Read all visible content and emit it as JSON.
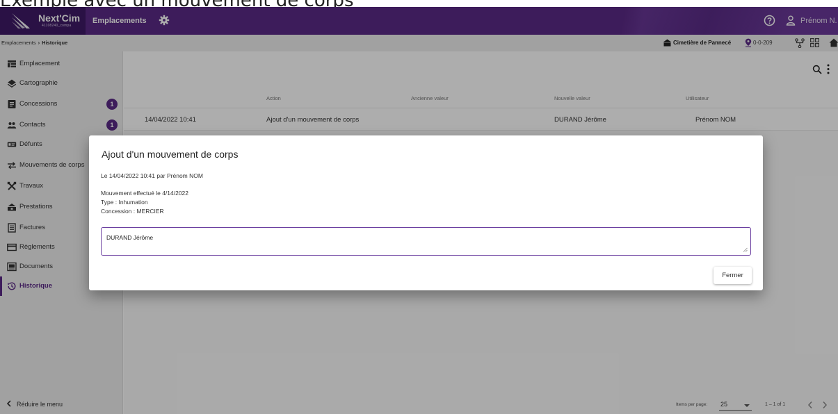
{
  "caption": "Exemple avec un mouvement de corps",
  "header": {
    "brand_name": "Next'Cim",
    "brand_sub": "41108240_compa",
    "app_title": "Emplacements",
    "user_name": "Prénom N.",
    "accent_color": "#5b2a86"
  },
  "breadcrumb": {
    "parent": "Emplacements",
    "separator": "›",
    "current": "Historique"
  },
  "context": {
    "cemetery": "Cimetière de Pannecé",
    "location": "0-0-209"
  },
  "sidebar": {
    "items": [
      {
        "label": "Emplacement",
        "icon": "emplacement-icon"
      },
      {
        "label": "Cartographie",
        "icon": "layers-icon"
      },
      {
        "label": "Concessions",
        "icon": "document-icon",
        "badge": "1"
      },
      {
        "label": "Contacts",
        "icon": "people-icon",
        "badge": "1"
      },
      {
        "label": "Défunts",
        "icon": "id-card-icon"
      },
      {
        "label": "Mouvements de corps",
        "icon": "move-arrows-icon"
      },
      {
        "label": "Travaux",
        "icon": "tools-icon"
      },
      {
        "label": "Prestations",
        "icon": "prestation-icon"
      },
      {
        "label": "Factures",
        "icon": "invoice-icon"
      },
      {
        "label": "Règlements",
        "icon": "payment-icon"
      },
      {
        "label": "Documents",
        "icon": "folder-icon"
      },
      {
        "label": "Historique",
        "icon": "history-icon",
        "active": true
      }
    ],
    "collapse_label": "Réduire le menu"
  },
  "table": {
    "columns": [
      "",
      "Action",
      "Ancienne valeur",
      "Nouvelle valeur",
      "Utilisateur"
    ],
    "rows": [
      {
        "date": "14/04/2022 10:41",
        "action": "Ajout d'un mouvement de corps",
        "old_value": "",
        "new_value": "DURAND Jérôme",
        "user": "Prénom NOM"
      }
    ]
  },
  "dialog": {
    "title": "Ajout d'un mouvement de corps",
    "meta": "Le 14/04/2022 10:41 par Prénom NOM",
    "details": [
      "Mouvement effectué le 4/14/2022",
      "Type : Inhumation",
      "Concession : MERCIER"
    ],
    "field_value": "DURAND Jérôme",
    "close_label": "Fermer"
  },
  "paginator": {
    "label": "Items per page:",
    "page_size": "25",
    "range": "1 – 1 of 1"
  }
}
